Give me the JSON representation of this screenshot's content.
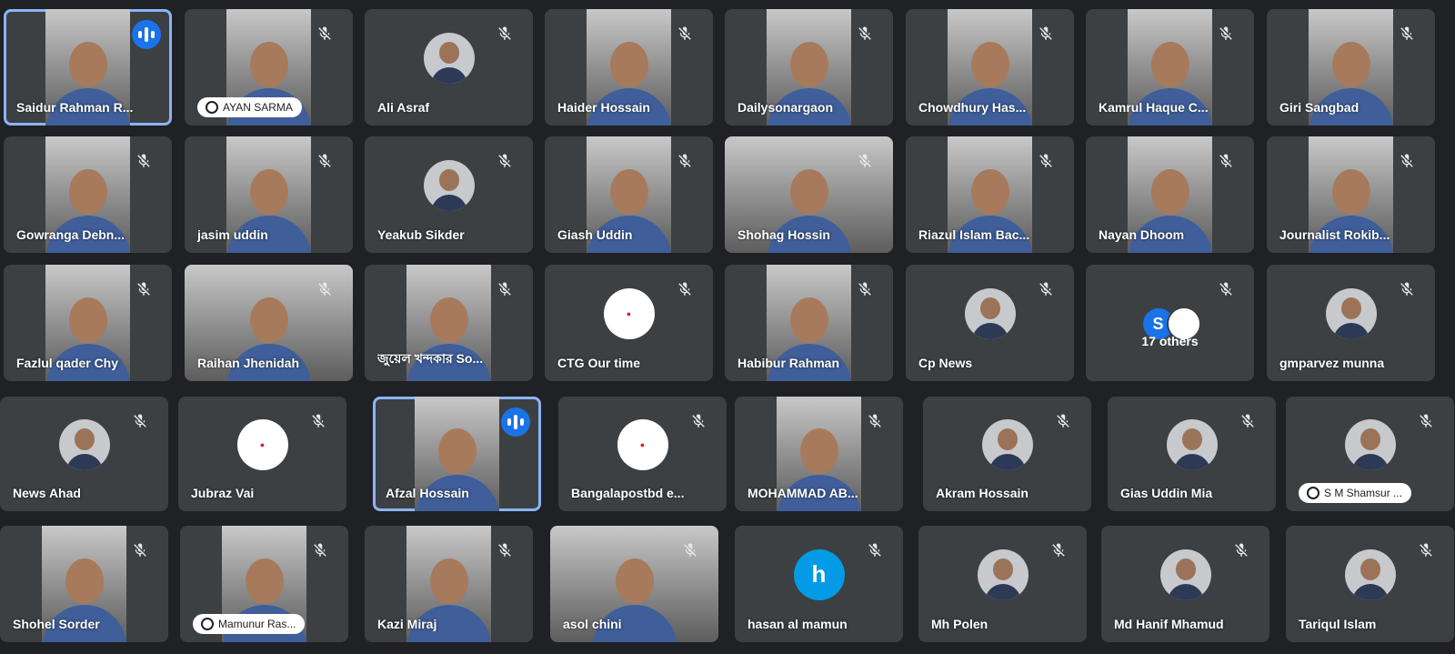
{
  "meeting": {
    "theme": {
      "tile_bg": "#3c4043",
      "page_bg": "#202124",
      "active_border": "#8ab4f8",
      "speaking_indicator": "#1a73e8"
    },
    "participants": [
      {
        "name": "Saidur Rahman R...",
        "kind": "video",
        "speaking": true,
        "active": true
      },
      {
        "name": "AYAN SARMA",
        "kind": "video",
        "pill": true
      },
      {
        "name": "Ali Asraf",
        "kind": "avatar-photo"
      },
      {
        "name": "Haider Hossain",
        "kind": "video"
      },
      {
        "name": "Dailysonargaon",
        "kind": "video"
      },
      {
        "name": "Chowdhury Has...",
        "kind": "video"
      },
      {
        "name": "Kamrul Haque C...",
        "kind": "video"
      },
      {
        "name": "Giri Sangbad",
        "kind": "video"
      },
      {
        "name": "Gowranga Debn...",
        "kind": "video"
      },
      {
        "name": "jasim uddin",
        "kind": "video"
      },
      {
        "name": "Yeakub Sikder",
        "kind": "avatar-photo"
      },
      {
        "name": "Giash Uddin",
        "kind": "video"
      },
      {
        "name": "Shohag Hossin",
        "kind": "video",
        "full": true
      },
      {
        "name": "Riazul Islam Bac...",
        "kind": "video"
      },
      {
        "name": "Nayan Dhoom",
        "kind": "video"
      },
      {
        "name": "Journalist Rokib...",
        "kind": "video"
      },
      {
        "name": "Fazlul qader Chy",
        "kind": "video"
      },
      {
        "name": "Raihan Jhenidah",
        "kind": "video",
        "full": true
      },
      {
        "name": "জুয়েল খন্দকার So...",
        "kind": "video"
      },
      {
        "name": "CTG Our time",
        "kind": "avatar-logo"
      },
      {
        "name": "Habibur Rahman",
        "kind": "video"
      },
      {
        "name": "Cp News",
        "kind": "avatar-photo"
      },
      {
        "name": "17 others",
        "kind": "others",
        "bubble_letter": "S"
      },
      {
        "name": "gmparvez munna",
        "kind": "avatar-photo"
      },
      {
        "name": "News Ahad",
        "kind": "avatar-photo"
      },
      {
        "name": "Jubraz Vai",
        "kind": "avatar-logo"
      },
      {
        "name": "Afzal Hossain",
        "kind": "video",
        "speaking": true,
        "active": true
      },
      {
        "name": "Bangalapostbd e...",
        "kind": "avatar-logo"
      },
      {
        "name": "MOHAMMAD AB...",
        "kind": "video"
      },
      {
        "name": "Akram Hossain",
        "kind": "avatar-photo"
      },
      {
        "name": "Gias Uddin Mia",
        "kind": "avatar-photo"
      },
      {
        "name": "S M Shamsur ...",
        "kind": "avatar-photo",
        "pill": true
      },
      {
        "name": "Shohel Sorder",
        "kind": "video"
      },
      {
        "name": "Mamunur Ras...",
        "kind": "video",
        "pill": true
      },
      {
        "name": "Kazi Miraj",
        "kind": "video"
      },
      {
        "name": "asol chini",
        "kind": "video",
        "full": true
      },
      {
        "name": "hasan al mamun",
        "kind": "avatar-letter",
        "letter": "h"
      },
      {
        "name": "Mh Polen",
        "kind": "avatar-photo"
      },
      {
        "name": "Md Hanif Mhamud",
        "kind": "avatar-photo"
      },
      {
        "name": "Tariqul Islam",
        "kind": "avatar-photo"
      }
    ]
  }
}
